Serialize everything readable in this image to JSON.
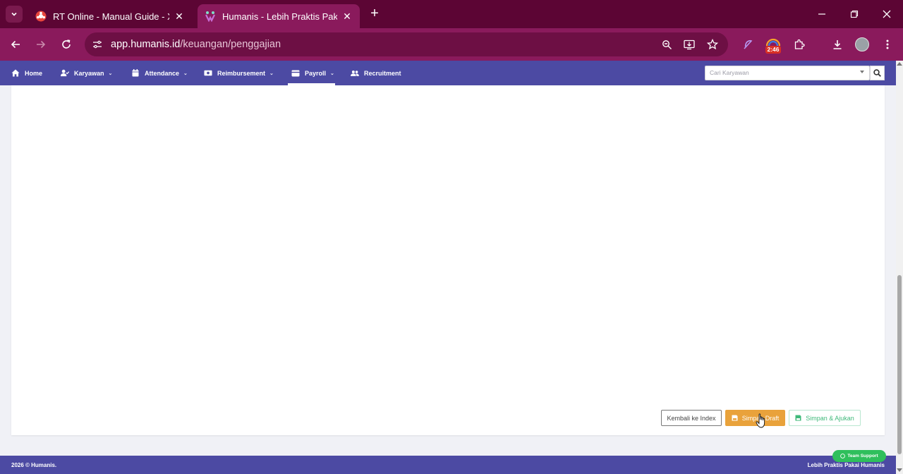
{
  "browser": {
    "tabs": [
      {
        "title": "RT Online - Manual Guide - Xmi",
        "active": false
      },
      {
        "title": "Humanis - Lebih Praktis Pakai Hu",
        "active": true
      }
    ],
    "url_domain": "app.humanis.id",
    "url_path": "/keuangan/penggajian",
    "extension_badge": "2:46",
    "accent_color": "#8a1a5c",
    "tabbar_color": "#5c0534"
  },
  "nav": {
    "items": [
      {
        "label": "Home",
        "icon": "home-icon",
        "has_dropdown": false
      },
      {
        "label": "Karyawan",
        "icon": "user-check-icon",
        "has_dropdown": true
      },
      {
        "label": "Attendance",
        "icon": "calendar-icon",
        "has_dropdown": true
      },
      {
        "label": "Reimbursement",
        "icon": "money-icon",
        "has_dropdown": true
      },
      {
        "label": "Payroll",
        "icon": "wallet-icon",
        "has_dropdown": true,
        "active": true
      },
      {
        "label": "Recruitment",
        "icon": "users-icon",
        "has_dropdown": false
      }
    ],
    "search_placeholder": "Cari Karyawan",
    "bar_color": "#4c4aa3"
  },
  "actions": {
    "back_label": "Kembali ke Index",
    "draft_label": "Simpan Draft",
    "submit_label": "Simpan & Ajukan",
    "draft_color": "#e9a23b",
    "submit_color": "#3fb97a"
  },
  "footer": {
    "copyright": "2026 © Humanis.",
    "tagline": "Lebih Praktis Pakai Humanis",
    "support_label": "Team Support"
  }
}
